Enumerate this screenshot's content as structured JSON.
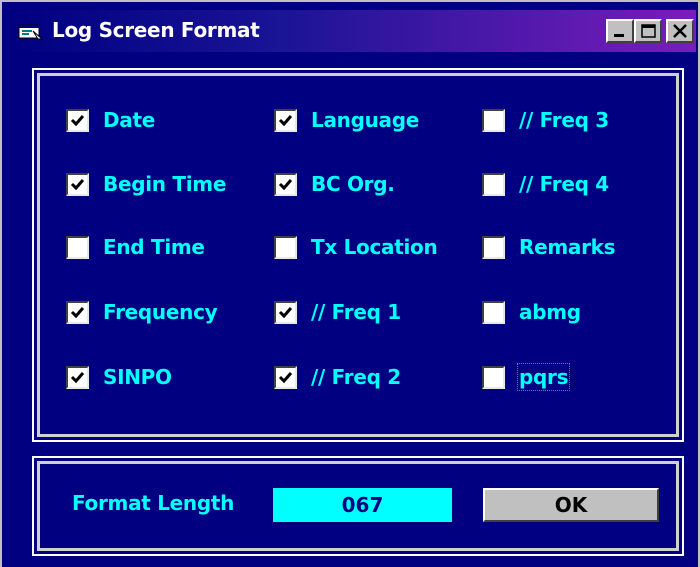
{
  "window": {
    "title": "Log Screen Format",
    "icon": "app-icon"
  },
  "titlebar_buttons": {
    "minimize": "minimize-icon",
    "maximize": "maximize-icon",
    "close": "close-icon"
  },
  "options": [
    {
      "label": "Date",
      "checked": true
    },
    {
      "label": "Begin Time",
      "checked": true
    },
    {
      "label": "End Time",
      "checked": false
    },
    {
      "label": "Frequency",
      "checked": true
    },
    {
      "label": "SINPO",
      "checked": true
    },
    {
      "label": "Language",
      "checked": true
    },
    {
      "label": "BC Org.",
      "checked": true
    },
    {
      "label": "Tx Location",
      "checked": false
    },
    {
      "label": "// Freq 1",
      "checked": true
    },
    {
      "label": "// Freq 2",
      "checked": true
    },
    {
      "label": "// Freq 3",
      "checked": false
    },
    {
      "label": "// Freq 4",
      "checked": false
    },
    {
      "label": "Remarks",
      "checked": false
    },
    {
      "label": "abmg",
      "checked": false
    },
    {
      "label": "pqrs",
      "checked": false,
      "focused": true
    }
  ],
  "footer": {
    "format_length_label": "Format Length",
    "format_length_value": "067",
    "ok_label": "OK"
  },
  "colors": {
    "window_bg": "#000080",
    "label_text": "#00ffff",
    "value_bg": "#00ffff",
    "button_face": "#c0c0c0"
  }
}
